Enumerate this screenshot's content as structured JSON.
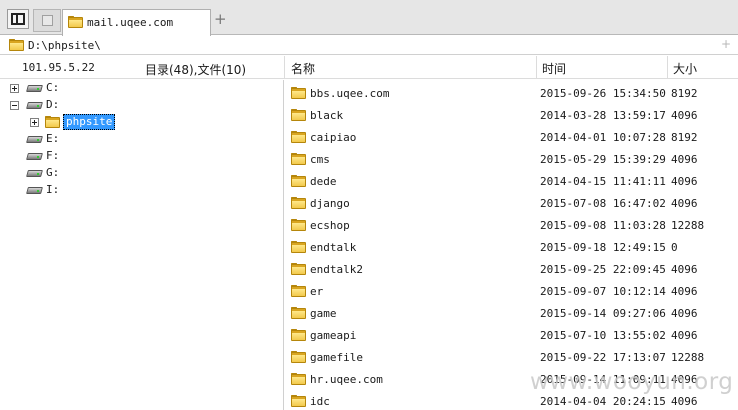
{
  "tabs": {
    "active_label": "mail.uqee.com",
    "new_tab_symbol": "+"
  },
  "address": {
    "path": "D:\\phpsite\\",
    "add_symbol": "+"
  },
  "header": {
    "ip": "101.95.5.22",
    "counts": "目录(48),文件(10)",
    "col_name": "名称",
    "col_time": "时间",
    "col_size": "大小"
  },
  "tree": [
    {
      "label": "C:",
      "expander": "plus",
      "level": 0,
      "icon": "drive-icon"
    },
    {
      "label": "D:",
      "expander": "minus",
      "level": 0,
      "icon": "drive-icon"
    },
    {
      "label": "phpsite",
      "expander": "plus",
      "level": 1,
      "icon": "folder-icon",
      "selected": true
    },
    {
      "label": "E:",
      "expander": "none",
      "level": 0,
      "icon": "drive-icon"
    },
    {
      "label": "F:",
      "expander": "none",
      "level": 0,
      "icon": "drive-icon"
    },
    {
      "label": "G:",
      "expander": "none",
      "level": 0,
      "icon": "drive-icon"
    },
    {
      "label": "I:",
      "expander": "none",
      "level": 0,
      "icon": "drive-icon"
    }
  ],
  "files": [
    {
      "name": "bbs.uqee.com",
      "time": "2015-09-26 15:34:50",
      "size": "8192"
    },
    {
      "name": "black",
      "time": "2014-03-28 13:59:17",
      "size": "4096"
    },
    {
      "name": "caipiao",
      "time": "2014-04-01 10:07:28",
      "size": "8192"
    },
    {
      "name": "cms",
      "time": "2015-05-29 15:39:29",
      "size": "4096"
    },
    {
      "name": "dede",
      "time": "2014-04-15 11:41:11",
      "size": "4096"
    },
    {
      "name": "django",
      "time": "2015-07-08 16:47:02",
      "size": "4096"
    },
    {
      "name": "ecshop",
      "time": "2015-09-08 11:03:28",
      "size": "12288"
    },
    {
      "name": "endtalk",
      "time": "2015-09-18 12:49:15",
      "size": "0"
    },
    {
      "name": "endtalk2",
      "time": "2015-09-25 22:09:45",
      "size": "4096"
    },
    {
      "name": "er",
      "time": "2015-09-07 10:12:14",
      "size": "4096"
    },
    {
      "name": "game",
      "time": "2015-09-14 09:27:06",
      "size": "4096"
    },
    {
      "name": "gameapi",
      "time": "2015-07-10 13:55:02",
      "size": "4096"
    },
    {
      "name": "gamefile",
      "time": "2015-09-22 17:13:07",
      "size": "12288"
    },
    {
      "name": "hr.uqee.com",
      "time": "2015-09-14 11:09:11",
      "size": "4096"
    },
    {
      "name": "idc",
      "time": "2014-04-04 20:24:15",
      "size": "4096"
    }
  ],
  "watermark": "www.wooyun.org"
}
